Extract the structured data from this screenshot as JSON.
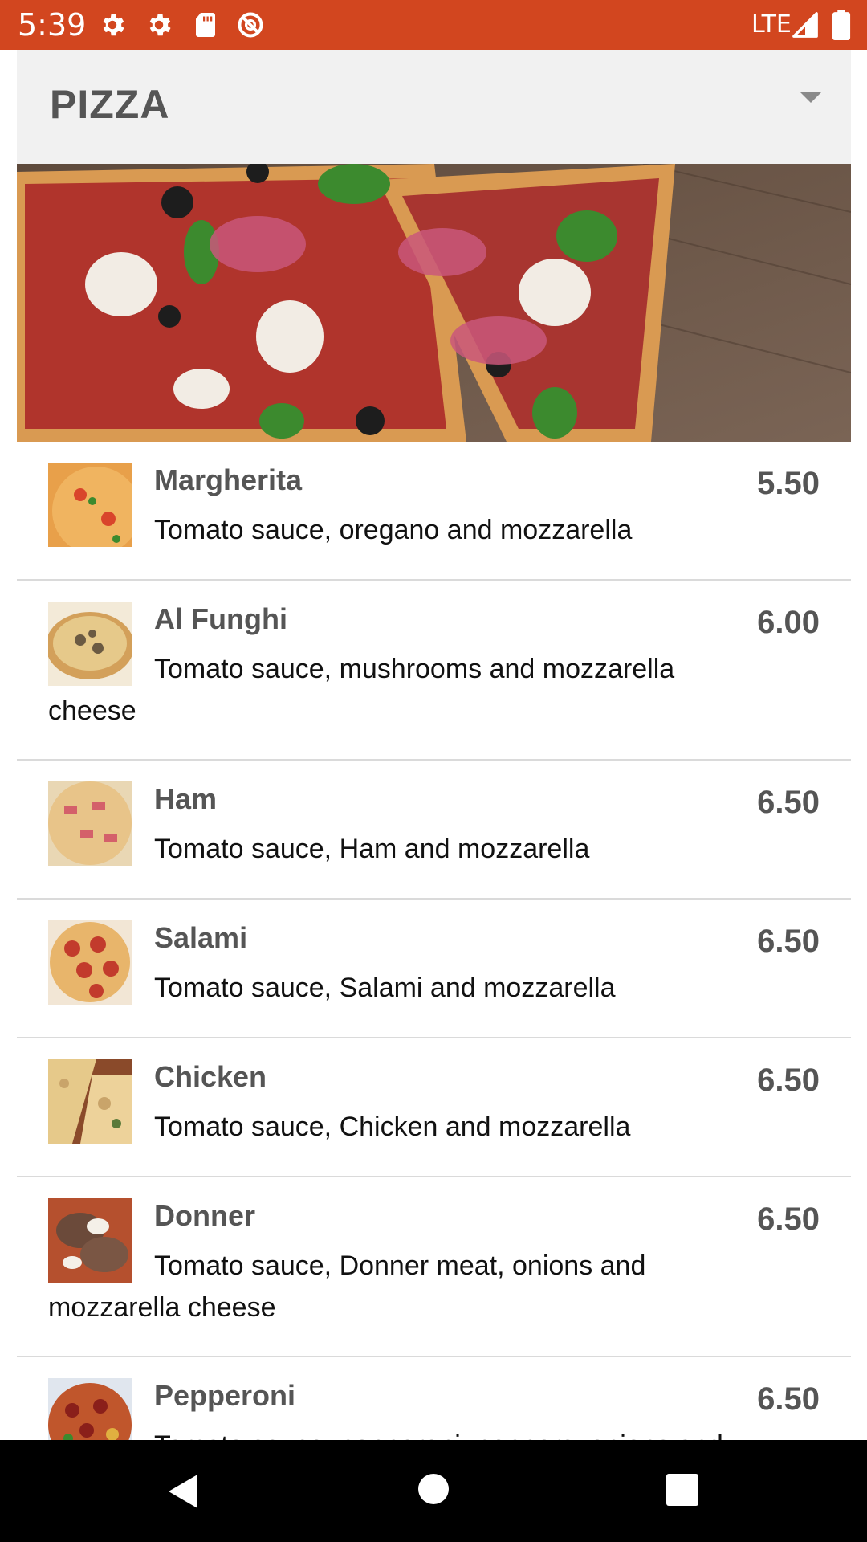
{
  "status_bar": {
    "time": "5:39",
    "icons": [
      "settings-icon",
      "settings-icon",
      "sd-card-icon",
      "do-not-disturb-icon"
    ],
    "network": "LTE",
    "right_icons": [
      "signal-icon",
      "battery-icon"
    ],
    "background": "#d2461f"
  },
  "category": {
    "title": "PIZZA",
    "dropdown_icon": "chevron-down-icon",
    "header_background": "#f1f1f1"
  },
  "hero": {
    "image": "pizza-hero-photo"
  },
  "menu": {
    "items": [
      {
        "name": "Margherita",
        "description": "Tomato sauce, oregano and mozzarella",
        "price": "5.50"
      },
      {
        "name": "Al Funghi",
        "description": "Tomato sauce, mushrooms and mozzarella cheese",
        "price": "6.00"
      },
      {
        "name": "Ham",
        "description": "Tomato sauce, Ham and mozzarella",
        "price": "6.50"
      },
      {
        "name": "Salami",
        "description": "Tomato sauce, Salami and mozzarella",
        "price": "6.50"
      },
      {
        "name": "Chicken",
        "description": "Tomato sauce, Chicken and mozzarella",
        "price": "6.50"
      },
      {
        "name": "Donner",
        "description": "Tomato sauce, Donner meat, onions and mozzarella cheese",
        "price": "6.50"
      },
      {
        "name": "Pepperoni",
        "description": "Tomato sauce, pepperoni, peppers, onions and mozzarella",
        "price": "6.50"
      }
    ]
  },
  "nav_bar": {
    "buttons": [
      "back-icon",
      "home-icon",
      "recents-icon"
    ]
  }
}
